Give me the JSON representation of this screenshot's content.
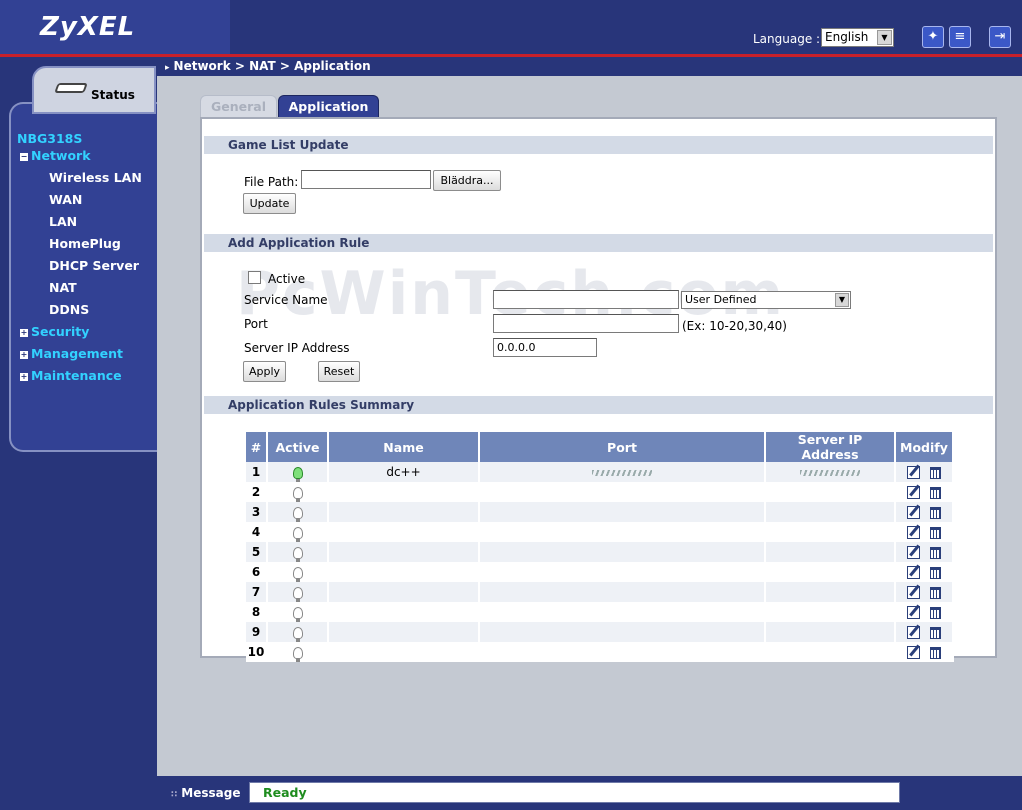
{
  "header": {
    "brand": "ZyXEL",
    "language_label": "Language :",
    "language_value": "English",
    "icons": [
      "wizard-icon",
      "about-icon",
      "logout-icon"
    ]
  },
  "sidebar": {
    "status_label": "Status",
    "device": "NBG318S",
    "items": [
      {
        "label": "Network",
        "type": "top",
        "state": "expanded"
      },
      {
        "label": "Wireless LAN",
        "type": "sub"
      },
      {
        "label": "WAN",
        "type": "sub"
      },
      {
        "label": "LAN",
        "type": "sub"
      },
      {
        "label": "HomePlug",
        "type": "sub"
      },
      {
        "label": "DHCP Server",
        "type": "sub"
      },
      {
        "label": "NAT",
        "type": "sub"
      },
      {
        "label": "DDNS",
        "type": "sub"
      },
      {
        "label": "Security",
        "type": "top",
        "state": "collapsed"
      },
      {
        "label": "Management",
        "type": "top",
        "state": "collapsed"
      },
      {
        "label": "Maintenance",
        "type": "top",
        "state": "collapsed"
      }
    ]
  },
  "breadcrumb": "Network > NAT > Application",
  "tabs": [
    {
      "label": "General",
      "active": false
    },
    {
      "label": "Application",
      "active": true
    }
  ],
  "game_list": {
    "title": "Game List Update",
    "file_path_label": "File Path:",
    "file_path_value": "",
    "browse_label": "Bläddra...",
    "update_label": "Update"
  },
  "add_rule": {
    "title": "Add Application Rule",
    "active_label": "Active",
    "active_checked": false,
    "service_name_label": "Service Name",
    "service_name_value": "",
    "service_select_value": "User Defined",
    "port_label": "Port",
    "port_value": "",
    "port_hint": "(Ex: 10-20,30,40)",
    "server_ip_label": "Server IP Address",
    "server_ip_value": "0.0.0.0",
    "apply_label": "Apply",
    "reset_label": "Reset"
  },
  "summary": {
    "title": "Application Rules Summary",
    "columns": [
      "#",
      "Active",
      "Name",
      "Port",
      "Server IP Address",
      "Modify"
    ],
    "rows": [
      {
        "num": "1",
        "active": true,
        "name": "dc++",
        "port": "",
        "ip": "",
        "redacted": true
      },
      {
        "num": "2",
        "active": false,
        "name": "",
        "port": "",
        "ip": "",
        "redacted": false
      },
      {
        "num": "3",
        "active": false,
        "name": "",
        "port": "",
        "ip": "",
        "redacted": false
      },
      {
        "num": "4",
        "active": false,
        "name": "",
        "port": "",
        "ip": "",
        "redacted": false
      },
      {
        "num": "5",
        "active": false,
        "name": "",
        "port": "",
        "ip": "",
        "redacted": false
      },
      {
        "num": "6",
        "active": false,
        "name": "",
        "port": "",
        "ip": "",
        "redacted": false
      },
      {
        "num": "7",
        "active": false,
        "name": "",
        "port": "",
        "ip": "",
        "redacted": false
      },
      {
        "num": "8",
        "active": false,
        "name": "",
        "port": "",
        "ip": "",
        "redacted": false
      },
      {
        "num": "9",
        "active": false,
        "name": "",
        "port": "",
        "ip": "",
        "redacted": false
      },
      {
        "num": "10",
        "active": false,
        "name": "",
        "port": "",
        "ip": "",
        "redacted": false
      }
    ]
  },
  "watermark": "PcWinTech.com",
  "message": {
    "label": "Message",
    "value": "Ready"
  },
  "colors": {
    "navy": "#28357a",
    "nav_accent": "#32d2ff",
    "table_header": "#6f86b9",
    "status_green": "#1e8c1e",
    "header_red_line": "#c8202a"
  }
}
